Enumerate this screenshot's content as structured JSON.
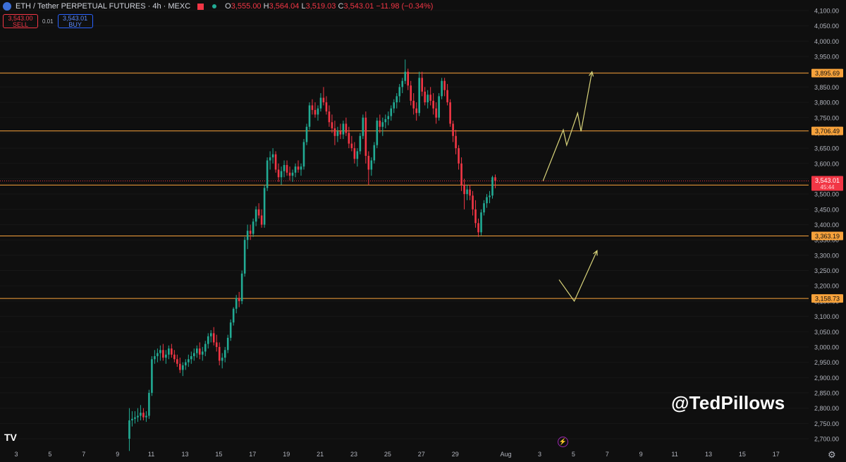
{
  "header": {
    "symbol": "ETH / Tether PERPETUAL FUTURES · 4h · MEXC",
    "o_label": "O",
    "o_value": "3,555.00",
    "h_label": "H",
    "h_value": "3,564.04",
    "l_label": "L",
    "l_value": "3,519.03",
    "c_label": "C",
    "c_value": "3,543.01",
    "change": "−11.98 (−0.34%)"
  },
  "trade": {
    "sell_price": "3,543.00",
    "sell_label": "SELL",
    "spread": "0.01",
    "buy_price": "3,543.01",
    "buy_label": "BUY"
  },
  "watermark": "@TedPillows",
  "logo_text": "TV",
  "colors": {
    "background": "#0f0f0f",
    "up": "#22ab94",
    "down": "#f23645",
    "level_line": "#f7a23b",
    "projection": "#d8d37a",
    "axis_text": "#b2b5be"
  },
  "chart_data": {
    "type": "candlestick",
    "ylim": [
      2680,
      4100
    ],
    "y_ticks": [
      4100,
      4050,
      4000,
      3950,
      3900,
      3850,
      3800,
      3750,
      3700,
      3650,
      3600,
      3550,
      3500,
      3450,
      3400,
      3350,
      3300,
      3250,
      3200,
      3150,
      3100,
      3050,
      3000,
      2950,
      2900,
      2850,
      2800,
      2750,
      2700
    ],
    "y_tick_labels": [
      "4,100.00",
      "4,050.00",
      "4,000.00",
      "3,950.00",
      "3,900.00",
      "3,850.00",
      "3,800.00",
      "3,750.00",
      "3,700.00",
      "3,650.00",
      "3,600.00",
      "3,550.00",
      "3,500.00",
      "3,450.00",
      "3,400.00",
      "3,350.00",
      "3,300.00",
      "3,250.00",
      "3,200.00",
      "3,150.00",
      "3,100.00",
      "3,050.00",
      "3,000.00",
      "2,950.00",
      "2,900.00",
      "2,850.00",
      "2,800.00",
      "2,750.00",
      "2,700.00"
    ],
    "x_labels": [
      "3",
      "5",
      "7",
      "9",
      "11",
      "13",
      "15",
      "17",
      "19",
      "21",
      "23",
      "25",
      "27",
      "29",
      "Aug",
      "3",
      "5",
      "7",
      "9",
      "11",
      "13",
      "15",
      "17"
    ],
    "x_label_days": [
      3,
      5,
      7,
      9,
      11,
      13,
      15,
      17,
      19,
      21,
      23,
      25,
      27,
      29,
      32,
      34,
      36,
      38,
      40,
      42,
      44,
      46,
      48
    ],
    "levels": [
      {
        "value": 3895.69,
        "label": "3,895.69"
      },
      {
        "value": 3706.49,
        "label": "3,706.49"
      },
      {
        "value": 3529.5,
        "label": "3,529.50"
      },
      {
        "value": 3363.19,
        "label": "3,363.19"
      },
      {
        "value": 3158.73,
        "label": "3,158.73"
      }
    ],
    "current_price": {
      "value": 3543.01,
      "label": "3,543.01",
      "countdown": "45:44"
    },
    "projections": [
      {
        "points": [
          [
            34.2,
            3543
          ],
          [
            35.4,
            3710
          ],
          [
            35.6,
            3660
          ],
          [
            36.25,
            3765
          ],
          [
            36.45,
            3705
          ],
          [
            37.1,
            3900
          ]
        ]
      },
      {
        "points": [
          [
            35.15,
            3220
          ],
          [
            36.05,
            3150
          ],
          [
            37.4,
            3315
          ]
        ]
      }
    ],
    "candle_start_day": 9.7,
    "candle_step_days": 0.1667,
    "candles": [
      [
        2700,
        2800,
        2660,
        2760
      ],
      [
        2760,
        2790,
        2740,
        2765
      ],
      [
        2765,
        2790,
        2750,
        2770
      ],
      [
        2770,
        2800,
        2755,
        2775
      ],
      [
        2775,
        2810,
        2760,
        2785
      ],
      [
        2785,
        2800,
        2760,
        2770
      ],
      [
        2770,
        2790,
        2755,
        2775
      ],
      [
        2775,
        2860,
        2765,
        2850
      ],
      [
        2850,
        2970,
        2840,
        2960
      ],
      [
        2960,
        2990,
        2945,
        2970
      ],
      [
        2970,
        2995,
        2950,
        2980
      ],
      [
        2980,
        3005,
        2955,
        2990
      ],
      [
        2990,
        3010,
        2955,
        2965
      ],
      [
        2965,
        2990,
        2945,
        2975
      ],
      [
        2975,
        3005,
        2960,
        2995
      ],
      [
        2995,
        3010,
        2965,
        2975
      ],
      [
        2975,
        2990,
        2950,
        2960
      ],
      [
        2960,
        2975,
        2935,
        2945
      ],
      [
        2945,
        2965,
        2915,
        2925
      ],
      [
        2925,
        2950,
        2905,
        2940
      ],
      [
        2940,
        2960,
        2925,
        2950
      ],
      [
        2950,
        2975,
        2935,
        2960
      ],
      [
        2960,
        2985,
        2945,
        2970
      ],
      [
        2970,
        2995,
        2955,
        2980
      ],
      [
        2980,
        3005,
        2965,
        2995
      ],
      [
        2995,
        3015,
        2960,
        2975
      ],
      [
        2975,
        3000,
        2955,
        2985
      ],
      [
        2985,
        3020,
        2970,
        3010
      ],
      [
        3010,
        3045,
        2995,
        3035
      ],
      [
        3035,
        3055,
        3015,
        3045
      ],
      [
        3045,
        3065,
        3005,
        3015
      ],
      [
        3015,
        3040,
        2985,
        3000
      ],
      [
        3000,
        3015,
        2940,
        2955
      ],
      [
        2955,
        2980,
        2930,
        2965
      ],
      [
        2965,
        3000,
        2950,
        2990
      ],
      [
        2990,
        3040,
        2980,
        3030
      ],
      [
        3030,
        3090,
        3020,
        3080
      ],
      [
        3080,
        3130,
        3070,
        3125
      ],
      [
        3125,
        3170,
        3110,
        3160
      ],
      [
        3160,
        3180,
        3130,
        3150
      ],
      [
        3150,
        3250,
        3140,
        3240
      ],
      [
        3240,
        3360,
        3230,
        3350
      ],
      [
        3350,
        3400,
        3320,
        3380
      ],
      [
        3380,
        3400,
        3350,
        3370
      ],
      [
        3370,
        3420,
        3360,
        3410
      ],
      [
        3410,
        3460,
        3395,
        3450
      ],
      [
        3450,
        3470,
        3420,
        3430
      ],
      [
        3430,
        3450,
        3390,
        3400
      ],
      [
        3400,
        3530,
        3390,
        3520
      ],
      [
        3520,
        3620,
        3510,
        3610
      ],
      [
        3610,
        3640,
        3580,
        3620
      ],
      [
        3620,
        3650,
        3600,
        3630
      ],
      [
        3630,
        3640,
        3570,
        3580
      ],
      [
        3580,
        3600,
        3540,
        3555
      ],
      [
        3555,
        3590,
        3530,
        3575
      ],
      [
        3575,
        3610,
        3555,
        3595
      ],
      [
        3595,
        3610,
        3560,
        3570
      ],
      [
        3570,
        3590,
        3545,
        3560
      ],
      [
        3560,
        3580,
        3540,
        3570
      ],
      [
        3570,
        3600,
        3555,
        3590
      ],
      [
        3590,
        3610,
        3570,
        3580
      ],
      [
        3580,
        3600,
        3560,
        3590
      ],
      [
        3590,
        3680,
        3580,
        3670
      ],
      [
        3670,
        3730,
        3660,
        3720
      ],
      [
        3720,
        3800,
        3710,
        3790
      ],
      [
        3790,
        3810,
        3760,
        3775
      ],
      [
        3775,
        3800,
        3750,
        3760
      ],
      [
        3760,
        3790,
        3740,
        3780
      ],
      [
        3780,
        3830,
        3770,
        3815
      ],
      [
        3815,
        3850,
        3790,
        3800
      ],
      [
        3800,
        3820,
        3760,
        3770
      ],
      [
        3770,
        3790,
        3720,
        3735
      ],
      [
        3735,
        3760,
        3700,
        3715
      ],
      [
        3715,
        3740,
        3660,
        3690
      ],
      [
        3690,
        3720,
        3670,
        3705
      ],
      [
        3705,
        3730,
        3680,
        3695
      ],
      [
        3695,
        3740,
        3680,
        3730
      ],
      [
        3730,
        3750,
        3690,
        3700
      ],
      [
        3700,
        3720,
        3650,
        3665
      ],
      [
        3665,
        3690,
        3640,
        3650
      ],
      [
        3650,
        3670,
        3600,
        3615
      ],
      [
        3615,
        3650,
        3590,
        3640
      ],
      [
        3640,
        3700,
        3630,
        3690
      ],
      [
        3690,
        3760,
        3680,
        3750
      ],
      [
        3750,
        3770,
        3600,
        3625
      ],
      [
        3625,
        3640,
        3530,
        3580
      ],
      [
        3580,
        3620,
        3560,
        3610
      ],
      [
        3610,
        3670,
        3600,
        3660
      ],
      [
        3660,
        3750,
        3650,
        3740
      ],
      [
        3740,
        3760,
        3700,
        3720
      ],
      [
        3720,
        3750,
        3690,
        3735
      ],
      [
        3735,
        3760,
        3715,
        3745
      ],
      [
        3745,
        3770,
        3725,
        3755
      ],
      [
        3755,
        3790,
        3740,
        3780
      ],
      [
        3780,
        3810,
        3765,
        3800
      ],
      [
        3800,
        3830,
        3780,
        3820
      ],
      [
        3820,
        3860,
        3800,
        3850
      ],
      [
        3850,
        3880,
        3830,
        3870
      ],
      [
        3870,
        3940,
        3860,
        3900
      ],
      [
        3900,
        3910,
        3840,
        3855
      ],
      [
        3855,
        3870,
        3790,
        3805
      ],
      [
        3805,
        3830,
        3760,
        3780
      ],
      [
        3780,
        3800,
        3740,
        3765
      ],
      [
        3765,
        3900,
        3755,
        3880
      ],
      [
        3880,
        3900,
        3820,
        3835
      ],
      [
        3835,
        3850,
        3790,
        3800
      ],
      [
        3800,
        3840,
        3780,
        3825
      ],
      [
        3825,
        3850,
        3790,
        3805
      ],
      [
        3805,
        3830,
        3760,
        3780
      ],
      [
        3780,
        3800,
        3730,
        3750
      ],
      [
        3750,
        3830,
        3740,
        3820
      ],
      [
        3820,
        3880,
        3810,
        3870
      ],
      [
        3870,
        3880,
        3820,
        3840
      ],
      [
        3840,
        3860,
        3790,
        3800
      ],
      [
        3800,
        3810,
        3720,
        3730
      ],
      [
        3730,
        3740,
        3670,
        3690
      ],
      [
        3690,
        3710,
        3630,
        3650
      ],
      [
        3650,
        3660,
        3580,
        3600
      ],
      [
        3600,
        3620,
        3510,
        3530
      ],
      [
        3530,
        3550,
        3450,
        3500
      ],
      [
        3500,
        3530,
        3480,
        3515
      ],
      [
        3515,
        3530,
        3480,
        3495
      ],
      [
        3495,
        3510,
        3430,
        3450
      ],
      [
        3450,
        3480,
        3390,
        3405
      ],
      [
        3405,
        3420,
        3360,
        3375
      ],
      [
        3375,
        3450,
        3365,
        3440
      ],
      [
        3440,
        3480,
        3430,
        3470
      ],
      [
        3470,
        3500,
        3455,
        3490
      ],
      [
        3490,
        3510,
        3470,
        3495
      ],
      [
        3495,
        3560,
        3485,
        3555
      ],
      [
        3555,
        3564,
        3519,
        3543
      ]
    ]
  }
}
